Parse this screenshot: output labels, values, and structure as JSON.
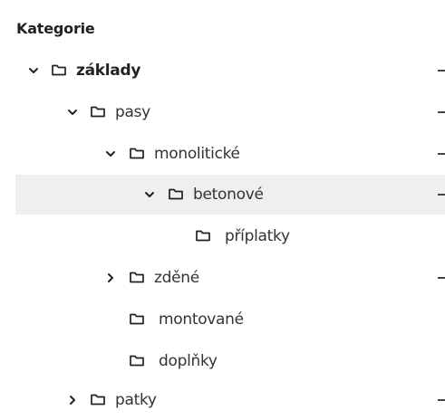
{
  "header": {
    "title": "Kategorie"
  },
  "tree": {
    "items": [
      {
        "label": "základy",
        "expanded": true,
        "has_children": true,
        "bold": true,
        "actions": true
      },
      {
        "label": "pasy",
        "expanded": true,
        "has_children": true,
        "bold": false,
        "actions": true
      },
      {
        "label": "monolitické",
        "expanded": true,
        "has_children": true,
        "bold": false,
        "actions": true
      },
      {
        "label": "betonové",
        "expanded": true,
        "has_children": true,
        "bold": false,
        "actions": true,
        "selected": true
      },
      {
        "label": "příplatky",
        "expanded": false,
        "has_children": false,
        "bold": false,
        "actions": false
      },
      {
        "label": "zděné",
        "expanded": false,
        "has_children": true,
        "bold": false,
        "actions": true
      },
      {
        "label": "montované",
        "expanded": false,
        "has_children": false,
        "bold": false,
        "actions": false
      },
      {
        "label": "doplňky",
        "expanded": false,
        "has_children": false,
        "bold": false,
        "actions": false
      },
      {
        "label": "patky",
        "expanded": false,
        "has_children": true,
        "bold": false,
        "actions": true
      }
    ]
  },
  "icons": {
    "expanded": "chevron-down-icon",
    "collapsed": "chevron-right-icon",
    "folder": "folder-icon",
    "actions": "more-actions-icon"
  },
  "colors": {
    "text": "#333333",
    "selected_row": "#efefef",
    "icon": "#222222"
  }
}
